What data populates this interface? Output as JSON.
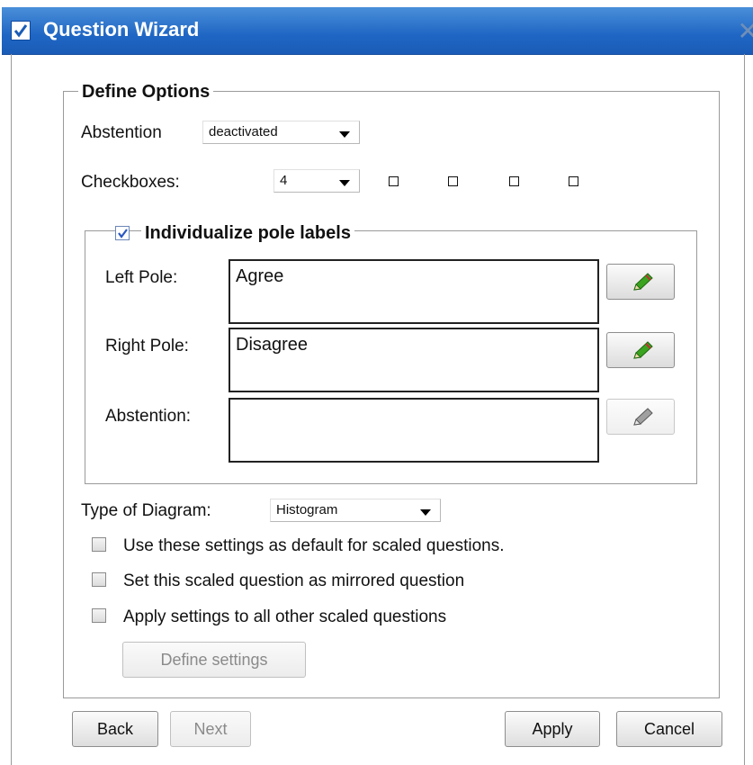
{
  "window": {
    "title": "Question Wizard"
  },
  "define_options": {
    "legend": "Define Options",
    "abstention_label": "Abstention",
    "abstention_value": "deactivated",
    "checkboxes_label": "Checkboxes:",
    "checkboxes_value": "4",
    "preview_checkbox_count": 4
  },
  "pole_labels": {
    "legend": "Individualize pole labels",
    "checked": true,
    "left_pole": {
      "label": "Left Pole:",
      "value": "Agree"
    },
    "right_pole": {
      "label": "Right Pole:",
      "value": "Disagree"
    },
    "abstention": {
      "label": "Abstention:",
      "value": ""
    }
  },
  "diagram": {
    "label": "Type of Diagram:",
    "value": "Histogram"
  },
  "options": [
    {
      "label": "Use these settings as default for scaled questions.",
      "checked": false
    },
    {
      "label": "Set this scaled question as mirrored question",
      "checked": false
    },
    {
      "label": "Apply settings to all other scaled questions",
      "checked": false
    }
  ],
  "define_settings_button": "Define settings",
  "footer": {
    "back": "Back",
    "next": "Next",
    "apply": "Apply",
    "cancel": "Cancel"
  },
  "colors": {
    "titlebar": "#1f66c4",
    "pen_active": "#3aa320",
    "pen_disabled": "#9a9a9a"
  }
}
